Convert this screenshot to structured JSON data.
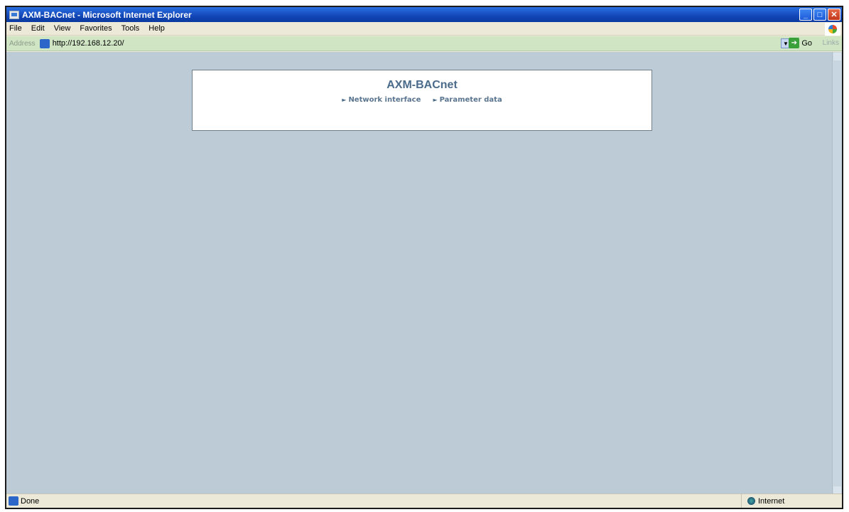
{
  "window": {
    "title": "AXM-BACnet - Microsoft Internet Explorer",
    "buttons": {
      "minimize": "_",
      "maximize": "□",
      "close": "✕"
    }
  },
  "menu": {
    "items": [
      "File",
      "Edit",
      "View",
      "Favorites",
      "Tools",
      "Help"
    ]
  },
  "address": {
    "label": "Address",
    "url": "http://192.168.12.20/",
    "go_label": "Go",
    "links_label": "Links"
  },
  "page": {
    "heading": "AXM-BACnet",
    "nav": [
      {
        "label": "Network interface"
      },
      {
        "label": "Parameter data"
      }
    ]
  },
  "status": {
    "text": "Done",
    "zone": "Internet"
  }
}
